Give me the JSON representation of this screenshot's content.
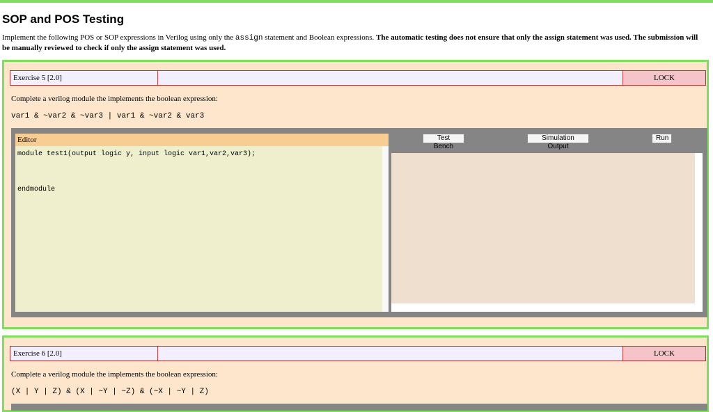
{
  "page": {
    "title": "SOP and POS Testing",
    "intro_prefix": "Implement the following POS or SOP expressions in Verilog using only the ",
    "intro_code": "assign",
    "intro_mid": " statement and Boolean expressions. ",
    "intro_bold": "The automatic testing does not ensure that only the assign statement was used. The submission will be manually reviewed to check if only the assign statement was used."
  },
  "exercises": [
    {
      "label": "Exercise 5 [2.0]",
      "lock_label": "LOCK",
      "description": "Complete a verilog module the implements the boolean expression:",
      "expression": "var1 & ~var2 & ~var3 | var1 & ~var2 & var3",
      "editor_label": "Editor",
      "code": "module test1(output logic y, input logic var1,var2,var3);\n\n\nendmodule",
      "buttons": {
        "test_bench": "Test Bench",
        "simulation_output": "Simulation Output",
        "run": "Run"
      }
    },
    {
      "label": "Exercise 6 [2.0]",
      "lock_label": "LOCK",
      "description": "Complete a verilog module the implements the boolean expression:",
      "expression": "(X | Y | Z) & (X | ~Y | ~Z) & (~X | ~Y | Z)"
    }
  ],
  "colors": {
    "accent_border": "#7ce05a",
    "exercise_bg": "#fde6cc",
    "lock_bg": "#f5c4c8",
    "editor_header": "#f7cd91",
    "editor_bg": "#efefcd",
    "output_bg": "#efdfcf",
    "workspace_bg": "#858585"
  }
}
